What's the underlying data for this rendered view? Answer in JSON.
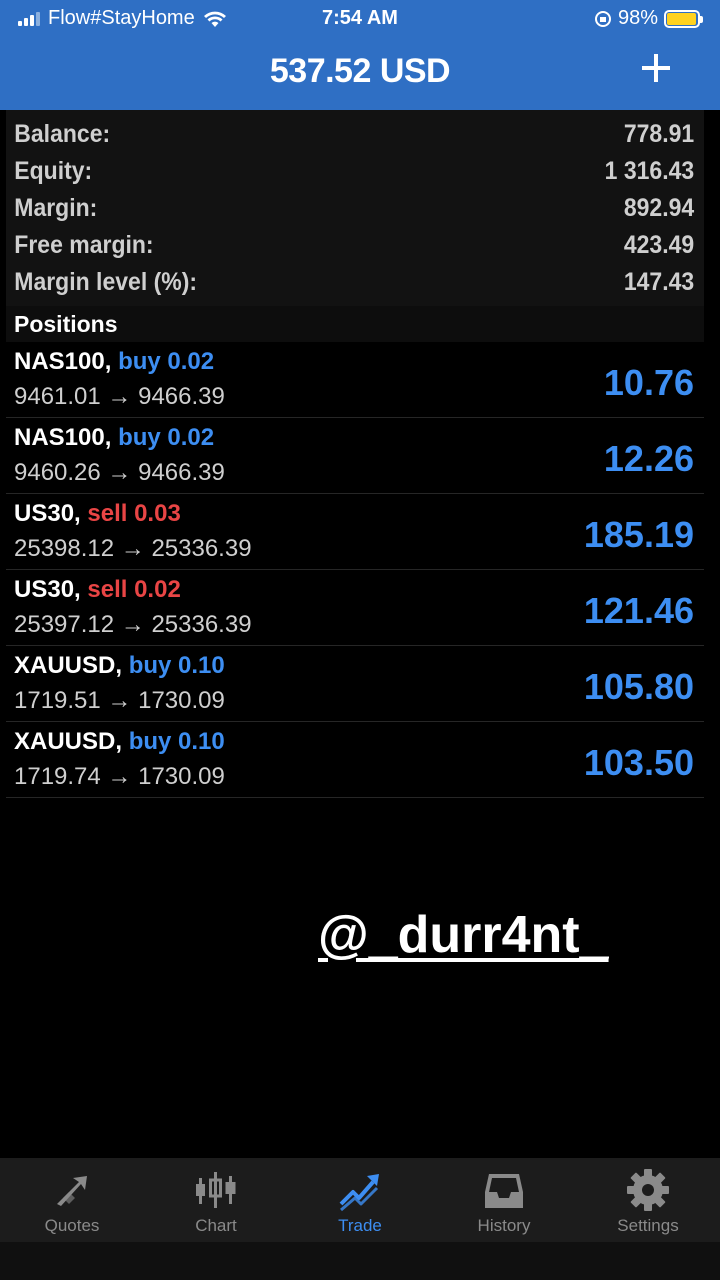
{
  "status_bar": {
    "carrier": "Flow#StayHome",
    "time": "7:54 AM",
    "battery_percent": "98%",
    "battery_level": 0.98
  },
  "header": {
    "title": "537.52 USD"
  },
  "summary": [
    {
      "label": "Balance:",
      "value": "778.91"
    },
    {
      "label": "Equity:",
      "value": "1 316.43"
    },
    {
      "label": "Margin:",
      "value": "892.94"
    },
    {
      "label": "Free margin:",
      "value": "423.49"
    },
    {
      "label": "Margin level (%):",
      "value": "147.43"
    }
  ],
  "positions_header": "Positions",
  "positions": [
    {
      "symbol": "NAS100,",
      "side": "buy 0.02",
      "prices": "9461.01 → 9466.39",
      "profit": "10.76",
      "color": "#3d8ef2"
    },
    {
      "symbol": "NAS100,",
      "side": "buy 0.02",
      "prices": "9460.26 → 9466.39",
      "profit": "12.26",
      "color": "#3d8ef2"
    },
    {
      "symbol": "US30,",
      "side": "sell 0.03",
      "prices": "25398.12 → 25336.39",
      "profit": "185.19",
      "color": "#e94545"
    },
    {
      "symbol": "US30,",
      "side": "sell 0.02",
      "prices": "25397.12 → 25336.39",
      "profit": "121.46",
      "color": "#e94545"
    },
    {
      "symbol": "XAUUSD,",
      "side": "buy 0.10",
      "prices": "1719.51 → 1730.09",
      "profit": "105.80",
      "color": "#3d8ef2"
    },
    {
      "symbol": "XAUUSD,",
      "side": "buy 0.10",
      "prices": "1719.74 → 1730.09",
      "profit": "103.50",
      "color": "#3d8ef2"
    }
  ],
  "watermark": "@_durr4nt_",
  "tabs": [
    {
      "label": "Quotes",
      "icon": "quotes-arrows-icon",
      "active": false
    },
    {
      "label": "Chart",
      "icon": "candlestick-icon",
      "active": false
    },
    {
      "label": "Trade",
      "icon": "trade-trend-icon",
      "active": true
    },
    {
      "label": "History",
      "icon": "inbox-tray-icon",
      "active": false
    },
    {
      "label": "Settings",
      "icon": "gear-icon",
      "active": false
    }
  ],
  "colors": {
    "header_blue": "#2f6fc4",
    "accent_blue": "#3d8ef2",
    "sell_red": "#e94545"
  }
}
